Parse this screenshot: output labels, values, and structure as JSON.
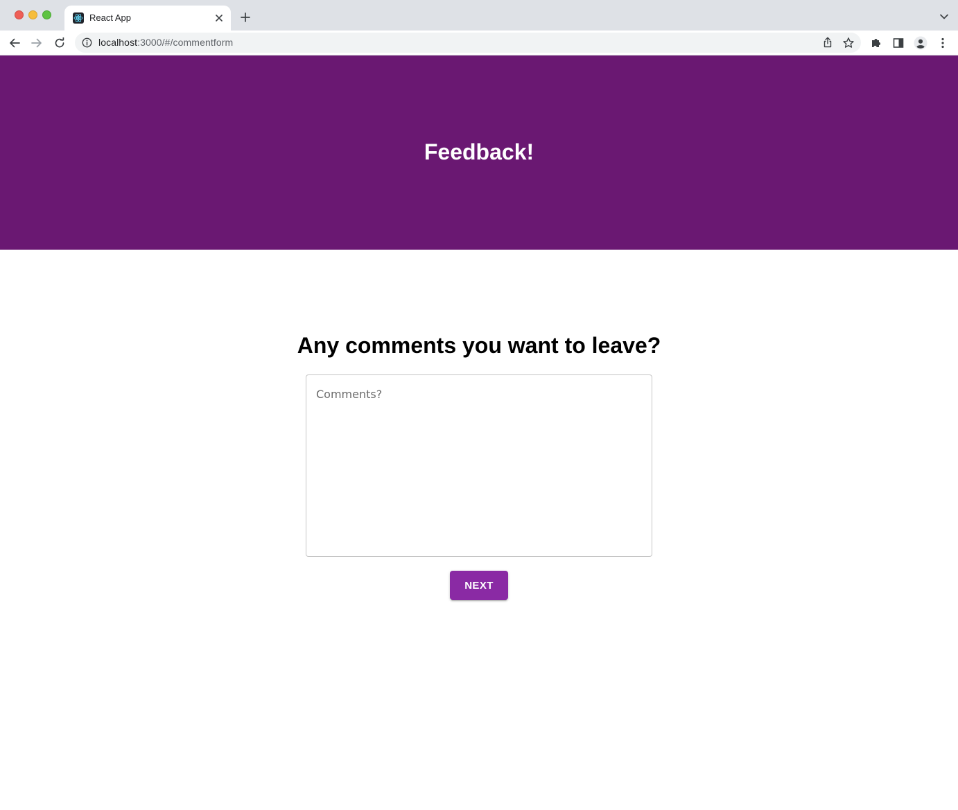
{
  "browser": {
    "tab_title": "React App",
    "url_host": "localhost",
    "url_rest": ":3000/#/commentform"
  },
  "page": {
    "hero_title": "Feedback!",
    "question": "Any comments you want to leave?",
    "comment_placeholder": "Comments?",
    "next_label": "NEXT"
  },
  "colors": {
    "hero_bg": "#6a1872",
    "button_bg": "#8a2aa4"
  },
  "icons": {
    "tab_favicon": "react-icon",
    "tab_close": "close-icon",
    "new_tab": "plus-icon",
    "tab_search": "chevron-down-icon",
    "back": "arrow-left-icon",
    "forward": "arrow-right-icon",
    "reload": "reload-icon",
    "site_info": "info-icon",
    "share": "share-icon",
    "bookmark": "star-icon",
    "extensions": "puzzle-icon",
    "side_panel": "side-panel-icon",
    "profile": "profile-icon",
    "menu": "kebab-menu-icon"
  }
}
